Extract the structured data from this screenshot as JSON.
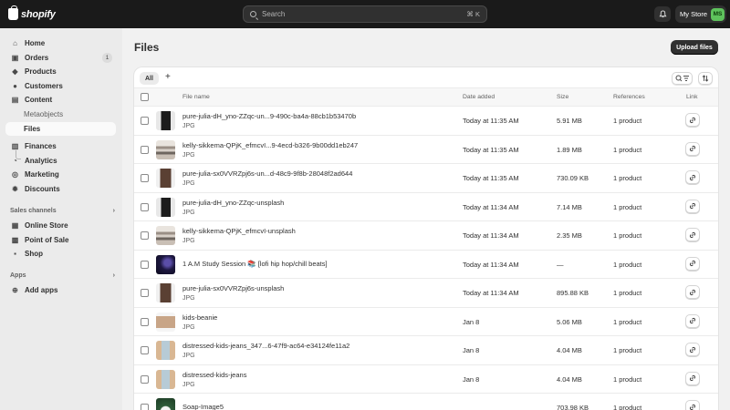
{
  "topbar": {
    "brand": "shopify",
    "search_placeholder": "Search",
    "search_shortcut": "⌘ K",
    "bell_icon": "bell-icon",
    "store_name": "My Store",
    "avatar_initials": "MS",
    "avatar_color": "#5ec25c"
  },
  "sidebar": {
    "items": [
      {
        "label": "Home",
        "icon": "home-icon",
        "glyph": "⌂"
      },
      {
        "label": "Orders",
        "icon": "orders-icon",
        "glyph": "▣",
        "badge": "1"
      },
      {
        "label": "Products",
        "icon": "tag-icon",
        "glyph": "◆"
      },
      {
        "label": "Customers",
        "icon": "person-icon",
        "glyph": "●"
      },
      {
        "label": "Content",
        "icon": "content-icon",
        "glyph": "▤"
      },
      {
        "label": "Metaobjects"
      },
      {
        "label": "Files"
      },
      {
        "label": "Finances",
        "icon": "bank-icon",
        "glyph": "▥"
      },
      {
        "label": "Analytics",
        "icon": "analytics-icon",
        "glyph": "◔"
      },
      {
        "label": "Marketing",
        "icon": "target-icon",
        "glyph": "◎"
      },
      {
        "label": "Discounts",
        "icon": "discount-icon",
        "glyph": "✹"
      }
    ],
    "sales_channels": {
      "heading": "Sales channels",
      "items": [
        {
          "label": "Online Store",
          "icon": "store-icon",
          "glyph": "▦"
        },
        {
          "label": "Point of Sale",
          "icon": "pos-icon",
          "glyph": "▩"
        },
        {
          "label": "Shop",
          "icon": "shop-icon",
          "glyph": "▪"
        }
      ]
    },
    "apps": {
      "heading": "Apps",
      "items": [
        {
          "label": "Add apps",
          "icon": "plus-circle-icon",
          "glyph": "⊕"
        }
      ]
    }
  },
  "main": {
    "title": "Files",
    "upload_label": "Upload files",
    "tabs": [
      {
        "label": "All"
      }
    ],
    "add_tab": "+",
    "columns": [
      "File name",
      "Date added",
      "Size",
      "References",
      "Link"
    ],
    "rows": [
      {
        "name": "pure-julia-dH_yno-ZZqc-un...9-490c-ba4a-88cb1b53470b",
        "type": "JPG",
        "date": "Today at 11:35 AM",
        "size": "5.91 MB",
        "refs": "1 product",
        "thumb": "dark-portrait"
      },
      {
        "name": "kelly-sikkema-QPjK_efmcvI...9-4ecd-b326-9b00dd1eb247",
        "type": "JPG",
        "date": "Today at 11:35 AM",
        "size": "1.89 MB",
        "refs": "1 product",
        "thumb": "stacked-clothes"
      },
      {
        "name": "pure-julia-sx0VVRZpj6s-un...d-48c9-9f8b-28048f2ad644",
        "type": "JPG",
        "date": "Today at 11:35 AM",
        "size": "730.09 KB",
        "refs": "1 product",
        "thumb": "brown-portrait"
      },
      {
        "name": "pure-julia-dH_yno-ZZqc-unsplash",
        "type": "JPG",
        "date": "Today at 11:34 AM",
        "size": "7.14 MB",
        "refs": "1 product",
        "thumb": "dark-portrait"
      },
      {
        "name": "kelly-sikkema-QPjK_efmcvI-unsplash",
        "type": "JPG",
        "date": "Today at 11:34 AM",
        "size": "2.35 MB",
        "refs": "1 product",
        "thumb": "stacked-clothes"
      },
      {
        "name": "1 A.M Study Session 📚 [lofi hip hop/chill beats]",
        "type": "",
        "date": "Today at 11:34 AM",
        "size": "—",
        "refs": "1 product",
        "thumb": "night-video"
      },
      {
        "name": "pure-julia-sx0VVRZpj6s-unsplash",
        "type": "JPG",
        "date": "Today at 11:34 AM",
        "size": "895.88 KB",
        "refs": "1 product",
        "thumb": "brown-portrait"
      },
      {
        "name": "kids-beanie",
        "type": "JPG",
        "date": "Jan 8",
        "size": "5.06 MB",
        "refs": "1 product",
        "thumb": "beanie"
      },
      {
        "name": "distressed-kids-jeans_347...6-47f9-ac64-e34124fe11a2",
        "type": "JPG",
        "date": "Jan 8",
        "size": "4.04 MB",
        "refs": "1 product",
        "thumb": "jeans"
      },
      {
        "name": "distressed-kids-jeans",
        "type": "JPG",
        "date": "Jan 8",
        "size": "4.04 MB",
        "refs": "1 product",
        "thumb": "jeans"
      },
      {
        "name": "Soap-Image5",
        "type": "",
        "date": "",
        "size": "703.98 KB",
        "refs": "1 product",
        "thumb": "soap"
      }
    ]
  }
}
